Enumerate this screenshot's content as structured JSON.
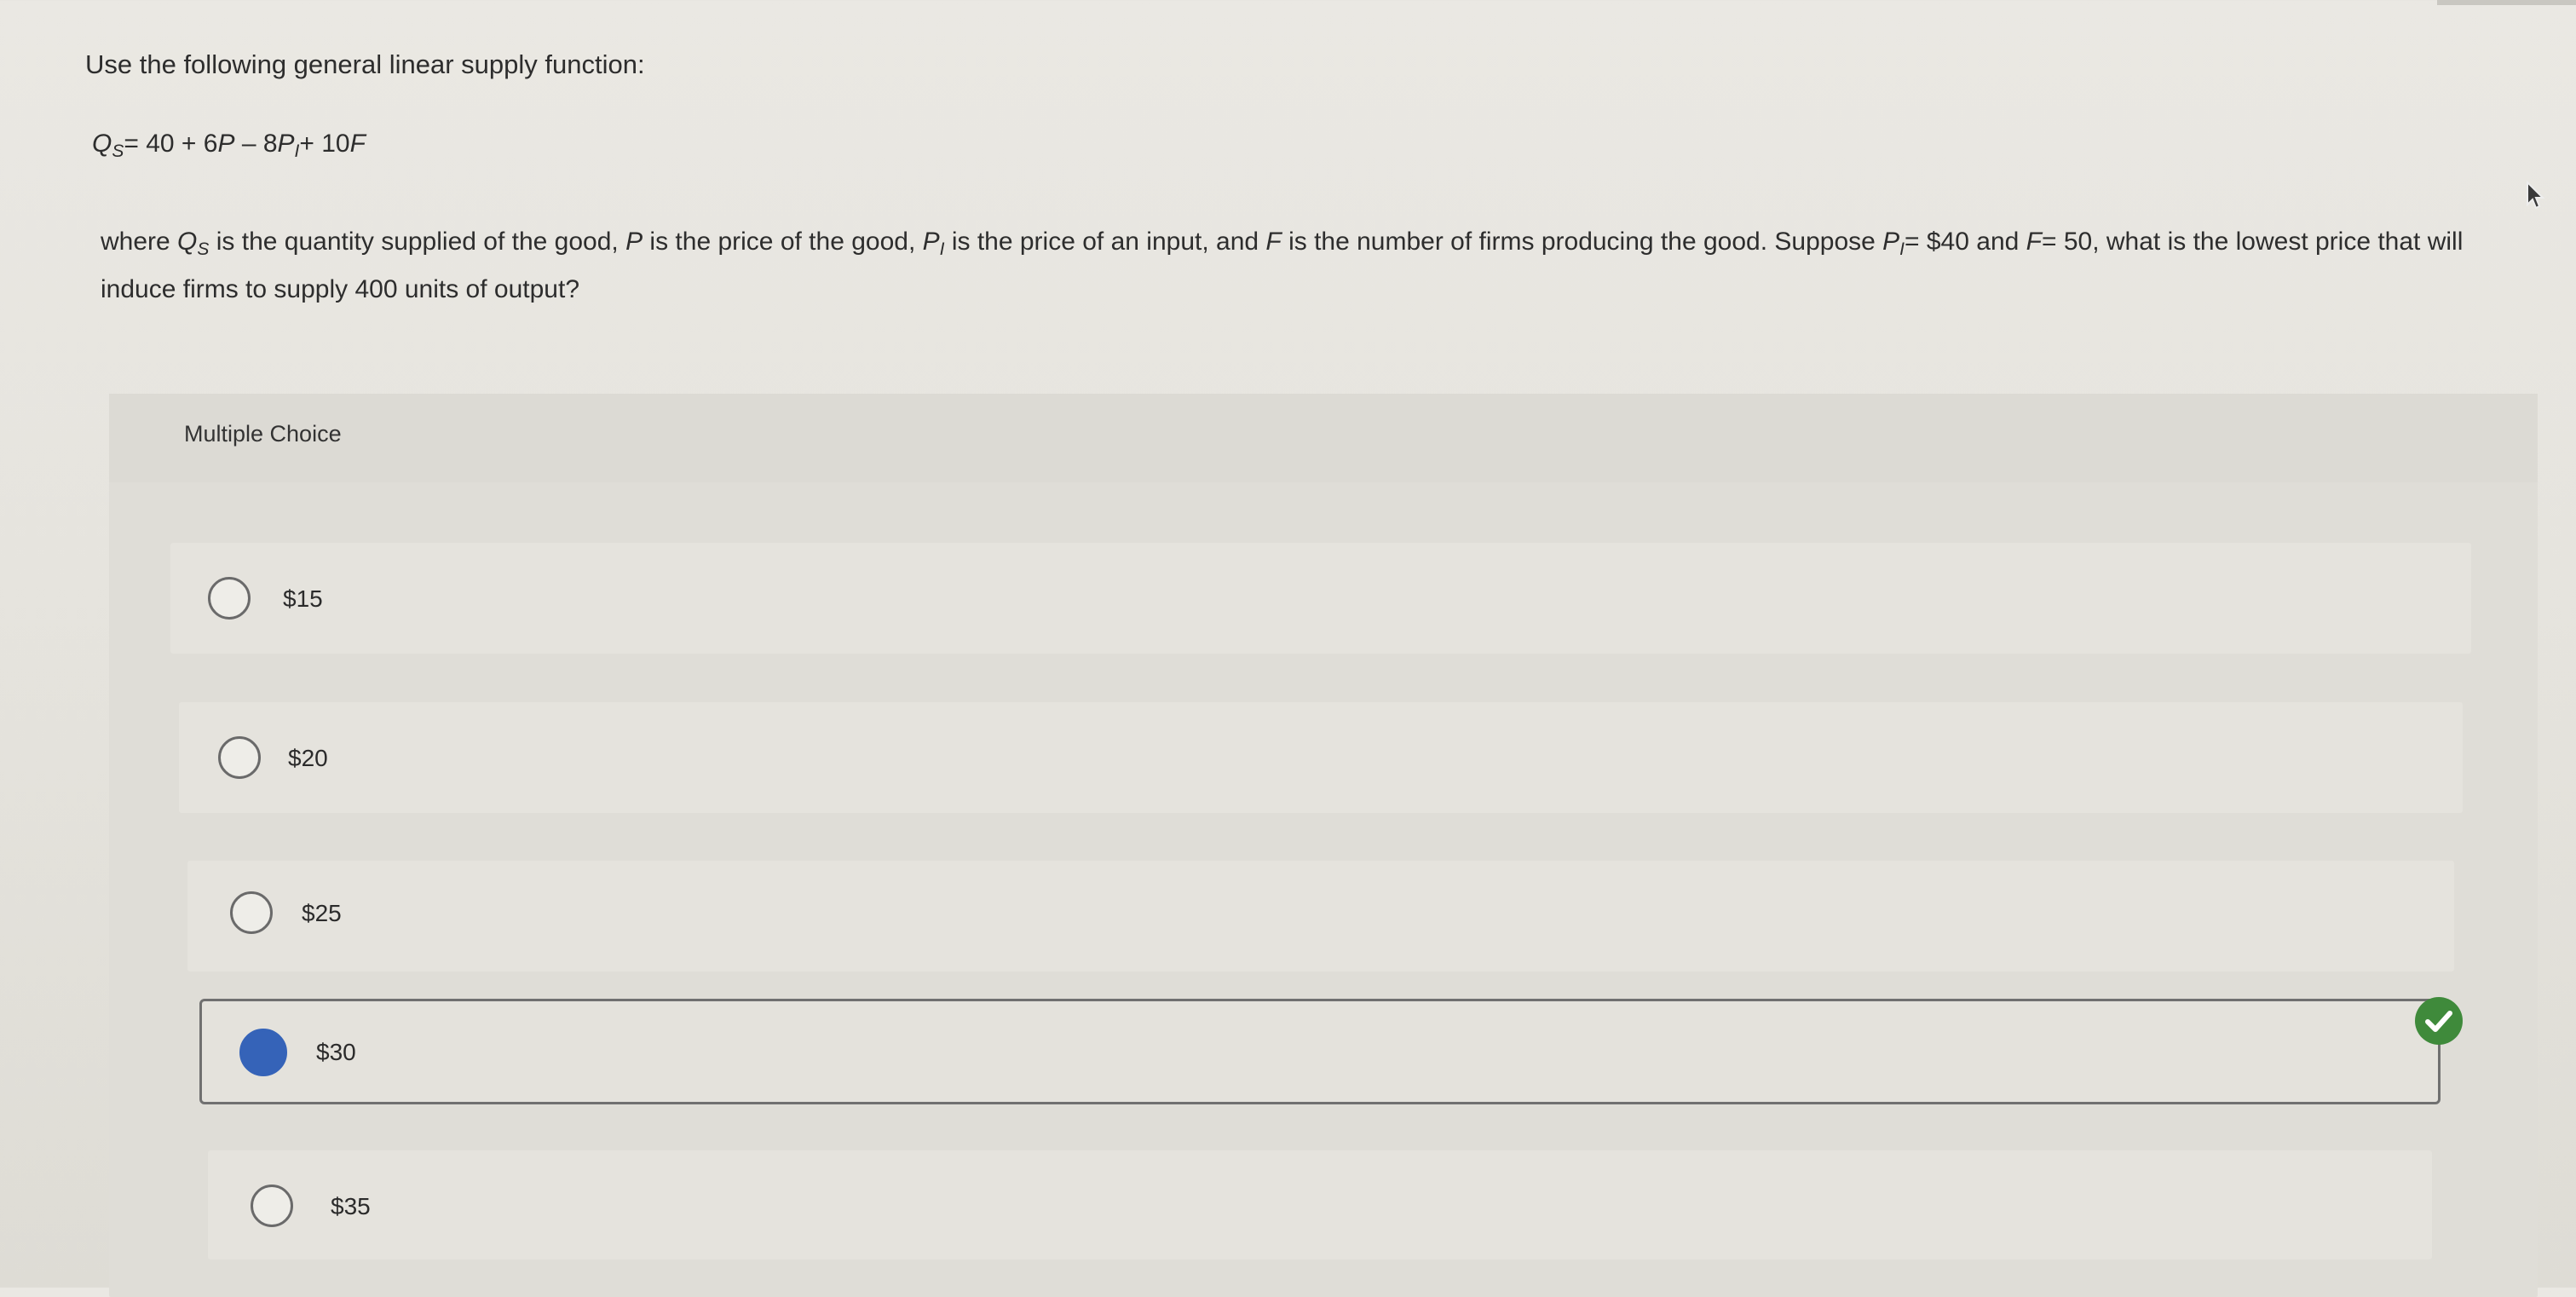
{
  "question": {
    "intro": "Use the following general linear supply function:",
    "equation": {
      "lhs": "Q",
      "lhs_sub": "S",
      "rhs_a": "= 40 + 6",
      "p": "P",
      "rhs_b": " – 8",
      "pi": "P",
      "pi_sub": "I",
      "rhs_c": "+ 10",
      "f": "F"
    },
    "body": {
      "t1": "where ",
      "q": "Q",
      "q_sub": "S",
      "t2": " is the quantity supplied of the good, ",
      "p": "P",
      "t3": " is the price of the good, ",
      "pi": "P",
      "pi_sub": "I",
      "t4": " is the price of an input, and ",
      "f": "F",
      "t5": " is the number of firms producing the good. Suppose ",
      "pi2": "P",
      "pi2_sub": "I",
      "t6": "= $40 and ",
      "f2": "F",
      "t7": "= 50, what is the lowest price that will induce firms to supply 400 units of output?"
    }
  },
  "multiple_choice": {
    "label": "Multiple Choice",
    "options": [
      {
        "label": "$15",
        "selected": false
      },
      {
        "label": "$20",
        "selected": false
      },
      {
        "label": "$25",
        "selected": false
      },
      {
        "label": "$30",
        "selected": true,
        "correct": true
      },
      {
        "label": "$35",
        "selected": false
      }
    ]
  },
  "colors": {
    "selected_radio": "#3563b8",
    "correct_check": "#3f8a3b"
  },
  "icons": {
    "correct": "checkmark-circle-icon",
    "cursor": "mouse-pointer-icon"
  }
}
